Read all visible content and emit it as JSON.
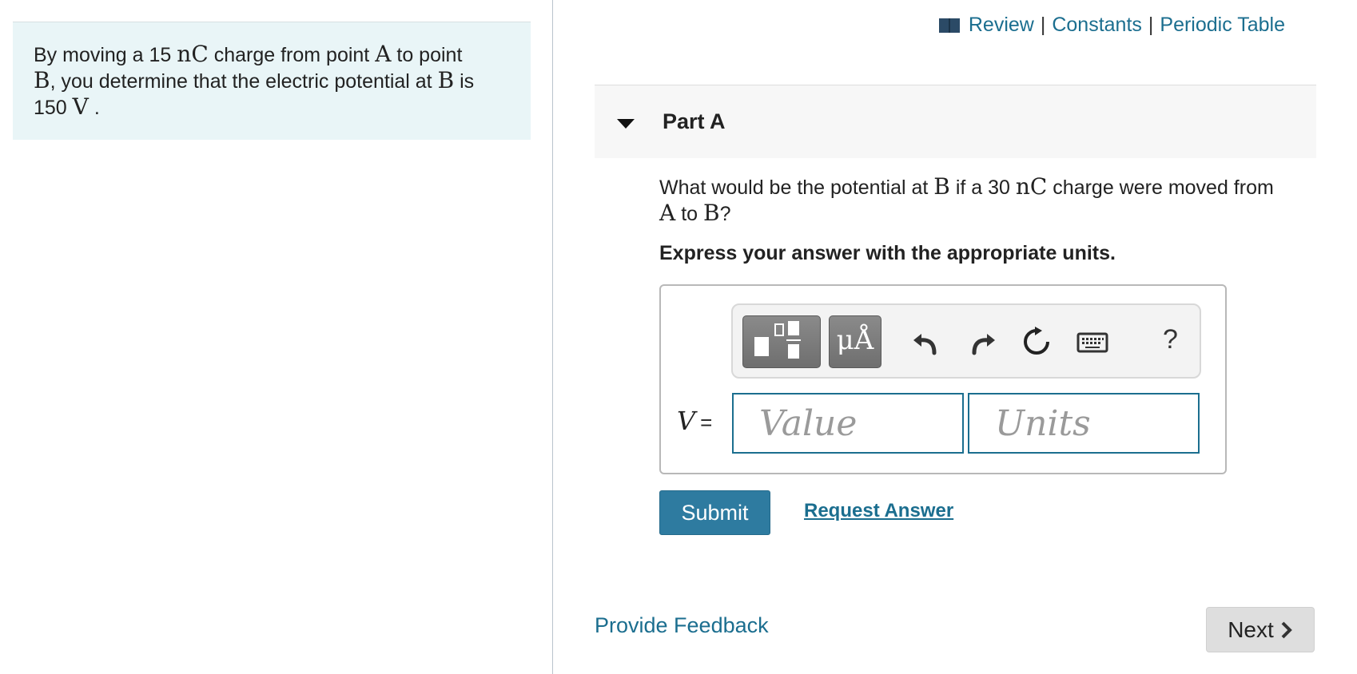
{
  "intro": {
    "t1": "By moving a 15",
    "unit1": "nC",
    "t2": "charge from point",
    "pA": "A",
    "t3": "to point",
    "pB": "B",
    "t4": ", you determine that the electric potential at",
    "pB2": "B",
    "t5": "is",
    "val": "150",
    "unit2": "V",
    "t6": "."
  },
  "top_links": {
    "review": "Review",
    "sep": "|",
    "constants": "Constants",
    "periodic_table": "Periodic Table"
  },
  "part": {
    "title": "Part A"
  },
  "question": {
    "t1": "What would be the potential at",
    "pB": "B",
    "t2": "if a 30",
    "unit": "nC",
    "t3": "charge were moved from",
    "pA": "A",
    "t4": "to",
    "pB2": "B",
    "t5": "?"
  },
  "instruction": "Express your answer with the appropriate units.",
  "answer": {
    "var": "V",
    "eq": "=",
    "value_placeholder": "Value",
    "units_placeholder": "Units",
    "units_button": "μÅ",
    "help": "?"
  },
  "actions": {
    "submit": "Submit",
    "request_answer": "Request Answer",
    "provide_feedback": "Provide Feedback",
    "next": "Next"
  }
}
